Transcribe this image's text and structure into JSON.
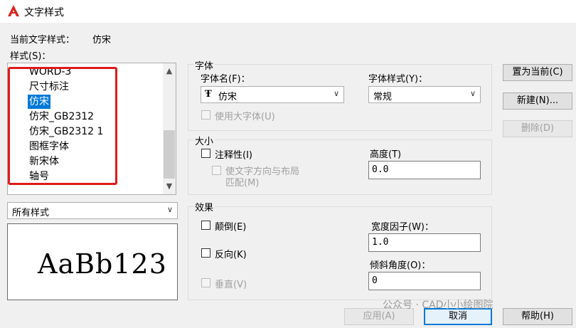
{
  "window": {
    "title": "文字样式"
  },
  "current_style": {
    "label": "当前文字样式：",
    "value": "仿宋"
  },
  "styles_label": "样式(S)：",
  "styles_list": [
    "WORD-3",
    "尺寸标注",
    "仿宋",
    "仿宋_GB2312",
    "仿宋_GB2312 1",
    "图框字体",
    "新宋体",
    "轴号"
  ],
  "selected_style": "仿宋",
  "filter_combo": {
    "value": "所有样式"
  },
  "preview_text": "AaBb123",
  "font_group": {
    "title": "字体",
    "font_name_label": "字体名(F)：",
    "font_name_value": "仿宋",
    "font_style_label": "字体样式(Y)：",
    "font_style_value": "常规",
    "bigfont_label": "使用大字体(U)"
  },
  "size_group": {
    "title": "大小",
    "annotative_label": "注释性(I)",
    "match_orientation_label_1": "使文字方向与布局",
    "match_orientation_label_2": "匹配(M)",
    "height_label": "高度(T)",
    "height_value": "0.0"
  },
  "effects_group": {
    "title": "效果",
    "upside_down_label": "颠倒(E)",
    "backwards_label": "反向(K)",
    "vertical_label": "垂直(V)",
    "width_factor_label": "宽度因子(W)：",
    "width_factor_value": "1.0",
    "oblique_label": "倾斜角度(O)：",
    "oblique_value": "0"
  },
  "buttons": {
    "set_current": "置为当前(C)",
    "new": "新建(N)...",
    "delete": "删除(D)",
    "apply": "应用(A)",
    "cancel": "取消",
    "help": "帮助(H)"
  },
  "watermark": "公众号 · CAD小小绘图院",
  "colors": {
    "selection": "#0078d7",
    "highlight": "#e01a1a",
    "logo": "#d9261c"
  }
}
